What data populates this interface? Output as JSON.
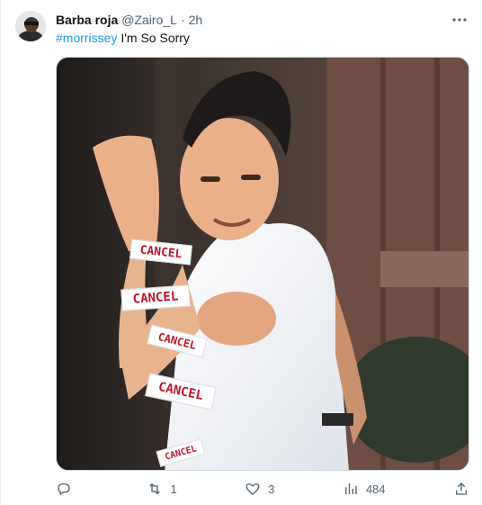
{
  "author": {
    "display_name": "Barba roja",
    "handle": "@Zairo_L",
    "separator": "·",
    "time": "2h"
  },
  "tweet": {
    "hashtag": "#morrissey",
    "text": " I'm So Sorry"
  },
  "media": {
    "stickers": [
      "CANCEL",
      "CANCEL",
      "CANCEL",
      "CANCEL",
      "CANCEL"
    ]
  },
  "actions": {
    "reply_count": "",
    "retweet_count": "1",
    "like_count": "3",
    "views_count": "484"
  },
  "icons": {
    "more": "more-dots-icon",
    "reply": "reply-icon",
    "retweet": "retweet-icon",
    "like": "heart-icon",
    "views": "views-chart-icon",
    "share": "share-icon"
  },
  "colors": {
    "link": "#1d9bf0",
    "muted": "#536471",
    "sticker_text": "#c0142c"
  }
}
